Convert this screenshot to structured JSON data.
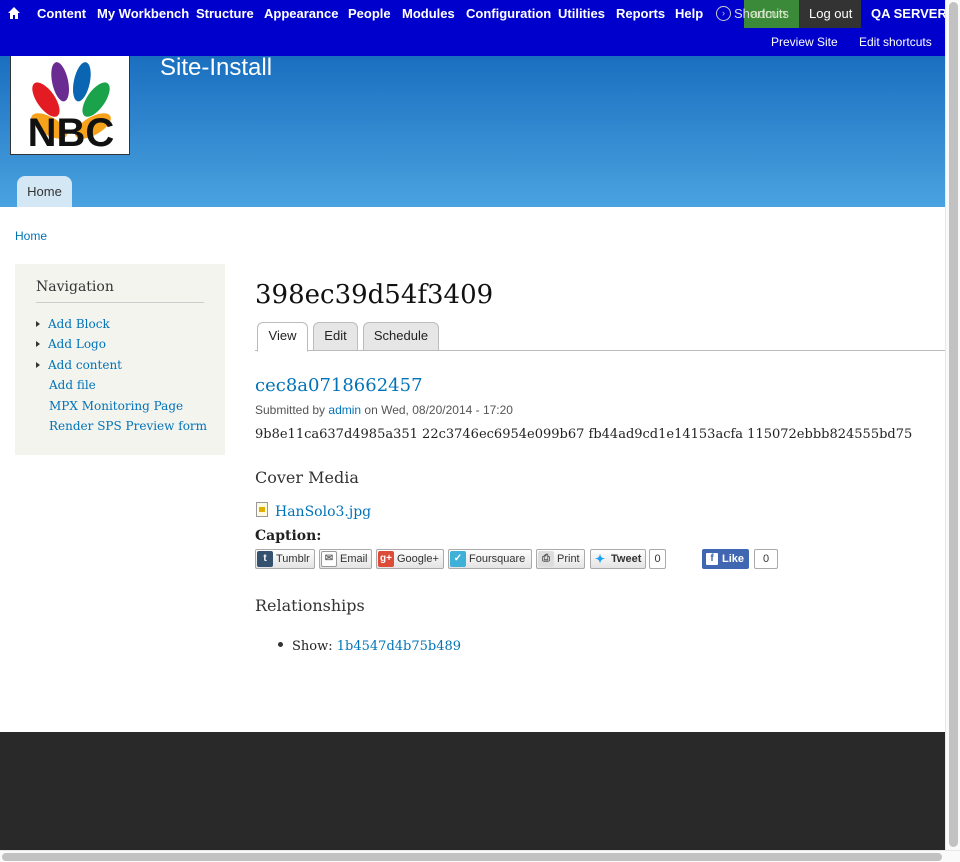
{
  "toolbar": {
    "items": [
      "Content",
      "My Workbench",
      "Structure",
      "Appearance",
      "People",
      "Modules",
      "Configuration",
      "Utilities",
      "Reports",
      "Help"
    ],
    "shortcuts": "Shortcuts",
    "admin": "admin",
    "logout": "Log out",
    "server": "QA SERVER",
    "preview_site": "Preview Site",
    "edit_shortcuts": "Edit shortcuts"
  },
  "header": {
    "site_name": "Site-Install",
    "logo_text": "NBC",
    "home_tab": "Home"
  },
  "breadcrumb": "Home",
  "sidebar": {
    "title": "Navigation",
    "items": [
      {
        "label": "Add Block",
        "has_arrow": true
      },
      {
        "label": "Add Logo",
        "has_arrow": true
      },
      {
        "label": "Add content",
        "has_arrow": true
      },
      {
        "label": "Add file",
        "has_arrow": false
      },
      {
        "label": "MPX Monitoring Page",
        "has_arrow": false
      },
      {
        "label": "Render SPS Preview form",
        "has_arrow": false
      }
    ]
  },
  "main": {
    "page_title": "398ec39d54f3409",
    "tabs": [
      "View",
      "Edit",
      "Schedule"
    ],
    "node_title": "cec8a0718662457",
    "submitted_prefix": "Submitted by",
    "submitted_user": "admin",
    "submitted_suffix": "on Wed, 08/20/2014 - 17:20",
    "body": "9b8e11ca637d4985a351 22c3746ec6954e099b67 fb44ad9cd1e14153acfa 115072ebbb824555bd75",
    "cover_media_heading": "Cover Media",
    "file_name": "HanSolo3.jpg",
    "caption_label": "Caption:",
    "share": {
      "tumblr": "Tumblr",
      "email": "Email",
      "googleplus": "Google+",
      "foursquare": "Foursquare",
      "print": "Print",
      "tweet": "Tweet",
      "tweet_count": "0",
      "like": "Like",
      "like_count": "0"
    },
    "relationships_heading": "Relationships",
    "relationship_label": "Show:",
    "relationship_value": "1b4547d4b75b489"
  },
  "colors": {
    "toolbar_bg": "#0000cc",
    "link": "#0073b8",
    "footer": "#292929"
  }
}
